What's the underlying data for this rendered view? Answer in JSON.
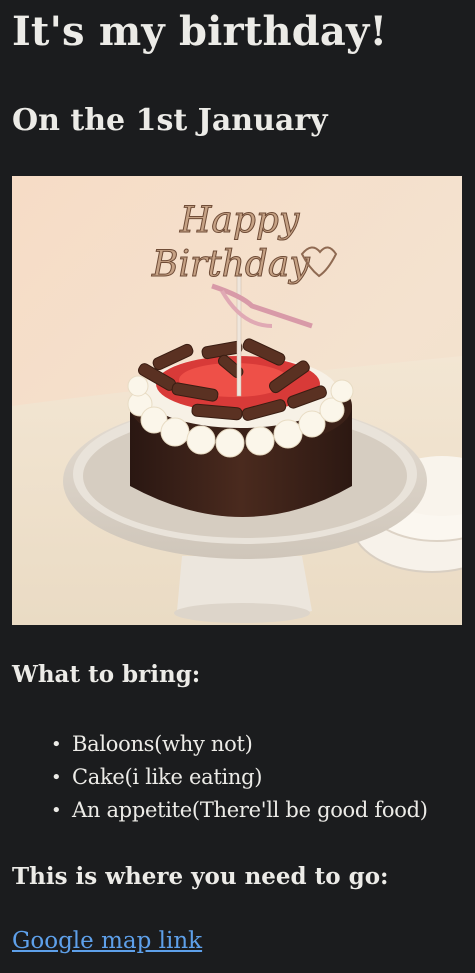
{
  "header": {
    "title": "It's my birthday!",
    "date": "On the 1st January"
  },
  "photo": {
    "topper_line1": "Happy",
    "topper_line2": "Birthday"
  },
  "bring": {
    "heading": "What to bring:",
    "items": [
      "Baloons(why not)",
      "Cake(i like eating)",
      "An appetite(There'll be good food)"
    ]
  },
  "location": {
    "heading": "This is where you need to go:",
    "link_label": "Google map link"
  },
  "colors": {
    "background": "#1b1c1e",
    "text": "#ecebe7",
    "link": "#5ea0ea"
  }
}
